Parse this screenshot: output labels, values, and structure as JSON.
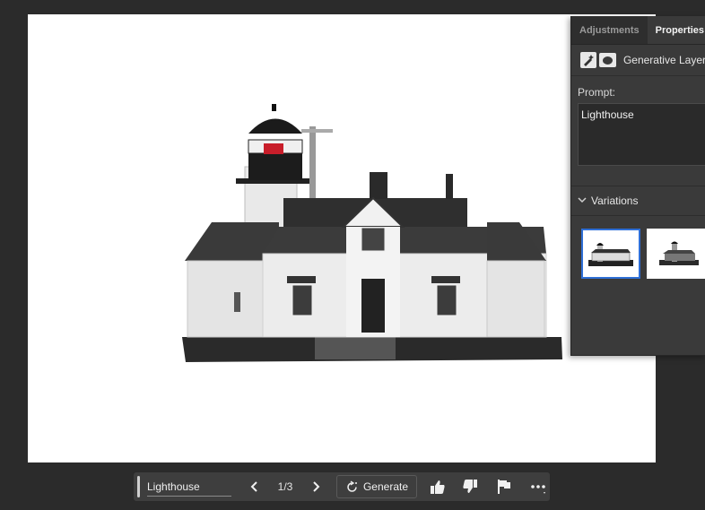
{
  "panel": {
    "tabs": [
      {
        "label": "Adjustments",
        "icon": "adjustments-tab"
      },
      {
        "label": "Properties",
        "icon": "properties-tab"
      }
    ],
    "layer_name": "Generative Layer",
    "prompt_label": "Prompt:",
    "prompt_value": "Lighthouse",
    "variations_label": "Variations",
    "selected_variation": 1
  },
  "taskbar": {
    "prompt_value": "Lighthouse",
    "page_indicator": "1/3",
    "generate_label": "Generate",
    "icons": [
      "chevron-left-icon",
      "chevron-right-icon",
      "refresh-icon",
      "thumbs-up-icon",
      "thumbs-down-icon",
      "flag-icon",
      "more-icon"
    ]
  },
  "colors": {
    "app_background": "#2b2b2b",
    "panel_background": "#3a3a3a",
    "selection_accent": "#2f6fd6",
    "lamp_red": "#c81e2a"
  }
}
